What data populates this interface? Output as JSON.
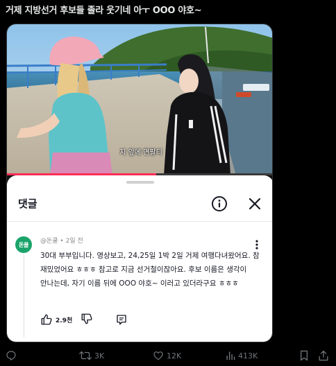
{
  "post": {
    "title": "거제 지방선거 후보들 졸라 웃기네 아ㅜ OOO 야호~"
  },
  "video": {
    "subtitle": "지 앞에 면팔티",
    "progress": 0.56
  },
  "comments_sheet": {
    "title": "댓글",
    "info_icon": "info-circle-icon",
    "close_icon": "close-icon",
    "comment": {
      "avatar_text": "돈쿨",
      "author": "@돈쿨",
      "time": "2일 전",
      "meta": "@돈쿨 • 2일 전",
      "body": "30대 부부입니다. 영상보고, 24,25일 1박 2일 거제 여행다녀왔어요. 참 재밌었어요 ㅎㅎㅎ 참고로 지금 선거철이잖아요. 후보 이름은 생각이 안나는데, 자기 이름 뒤에 OOO 야호~ 이러고 있더라구요 ㅎㅎㅎ",
      "like_count": "2.9천",
      "avatar_color": "#1aa36a"
    }
  },
  "actions": {
    "reply_icon": "comment-bubble-icon",
    "retweet_count": "3K",
    "like_count": "12K",
    "views_count": "413K"
  },
  "colors": {
    "accent": "#fe2c55",
    "icon_gray": "#71767b"
  }
}
